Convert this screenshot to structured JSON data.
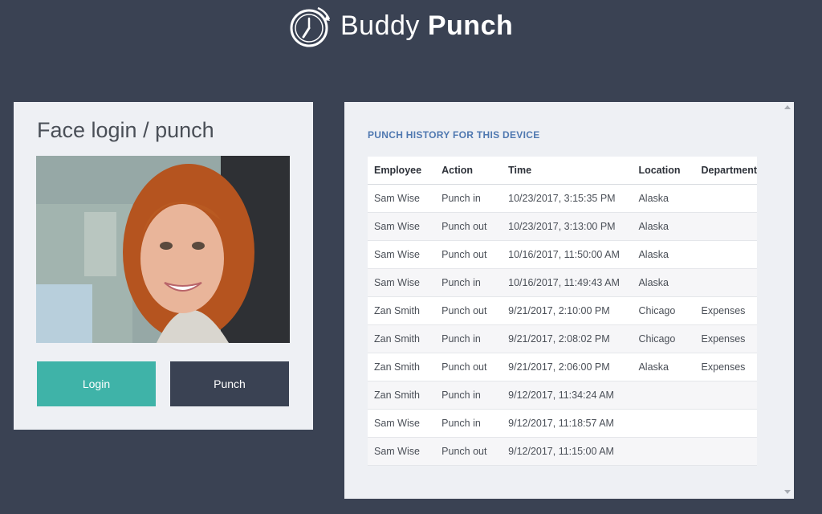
{
  "header": {
    "brand_light": "Buddy",
    "brand_bold": "Punch"
  },
  "face_card": {
    "title": "Face login / punch",
    "login_label": "Login",
    "punch_label": "Punch"
  },
  "history": {
    "title": "PUNCH HISTORY FOR THIS DEVICE",
    "columns": [
      "Employee",
      "Action",
      "Time",
      "Location",
      "Department"
    ],
    "rows": [
      [
        "Sam Wise",
        "Punch in",
        "10/23/2017, 3:15:35 PM",
        "Alaska",
        ""
      ],
      [
        "Sam Wise",
        "Punch out",
        "10/23/2017, 3:13:00 PM",
        "Alaska",
        ""
      ],
      [
        "Sam Wise",
        "Punch out",
        "10/16/2017, 11:50:00 AM",
        "Alaska",
        ""
      ],
      [
        "Sam Wise",
        "Punch in",
        "10/16/2017, 11:49:43 AM",
        "Alaska",
        ""
      ],
      [
        "Zan Smith",
        "Punch out",
        "9/21/2017, 2:10:00 PM",
        "Chicago",
        "Expenses"
      ],
      [
        "Zan Smith",
        "Punch in",
        "9/21/2017, 2:08:02 PM",
        "Chicago",
        "Expenses"
      ],
      [
        "Zan Smith",
        "Punch out",
        "9/21/2017, 2:06:00 PM",
        "Alaska",
        "Expenses"
      ],
      [
        "Zan Smith",
        "Punch in",
        "9/12/2017, 11:34:24 AM",
        "",
        ""
      ],
      [
        "Sam Wise",
        "Punch in",
        "9/12/2017, 11:18:57 AM",
        "",
        ""
      ],
      [
        "Sam Wise",
        "Punch out",
        "9/12/2017, 11:15:00 AM",
        "",
        ""
      ]
    ]
  },
  "colors": {
    "background": "#3a4253",
    "card": "#eef0f4",
    "login_button": "#3fb3a8",
    "punch_button": "#3a4253",
    "heading_accent": "#4f78b0"
  },
  "icons": {
    "logo": "stopwatch-icon",
    "scroll_up": "scroll-up-arrow-icon",
    "scroll_down": "scroll-down-arrow-icon"
  }
}
